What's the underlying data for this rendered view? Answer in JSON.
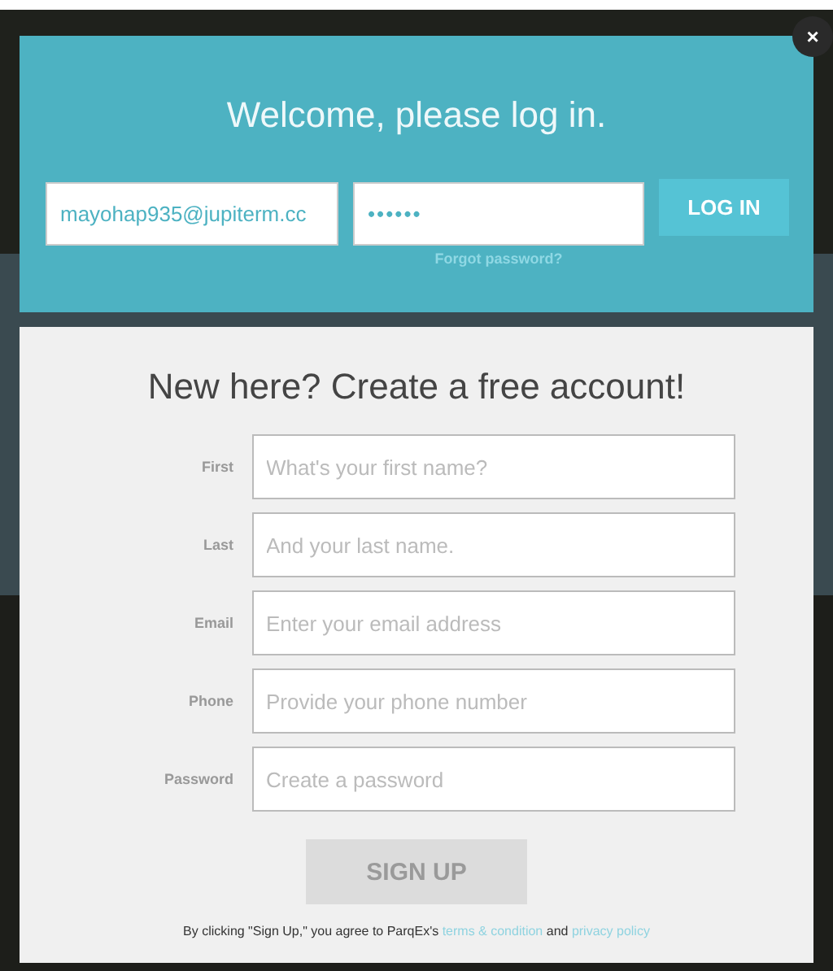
{
  "close_button": {
    "label": "×"
  },
  "login": {
    "title": "Welcome, please log in.",
    "email": {
      "value": "mayohap935@jupiterm.cc"
    },
    "password": {
      "value": "••••••"
    },
    "button": "LOG IN",
    "forgot_link": "Forgot password?"
  },
  "signup": {
    "title": "New here? Create a free account!",
    "fields": [
      {
        "label": "First",
        "placeholder": "What's your first name?"
      },
      {
        "label": "Last",
        "placeholder": "And your last name."
      },
      {
        "label": "Email",
        "placeholder": "Enter your email address"
      },
      {
        "label": "Phone",
        "placeholder": "Provide your phone number"
      },
      {
        "label": "Password",
        "placeholder": "Create a password"
      }
    ],
    "button": {
      "label": "SIGN UP",
      "disabled": true
    },
    "terms": {
      "before": "By clicking \"Sign Up,\" you agree to ParqEx's",
      "terms_link": "terms & condition",
      "middle": "and",
      "privacy_link": "privacy policy"
    }
  }
}
